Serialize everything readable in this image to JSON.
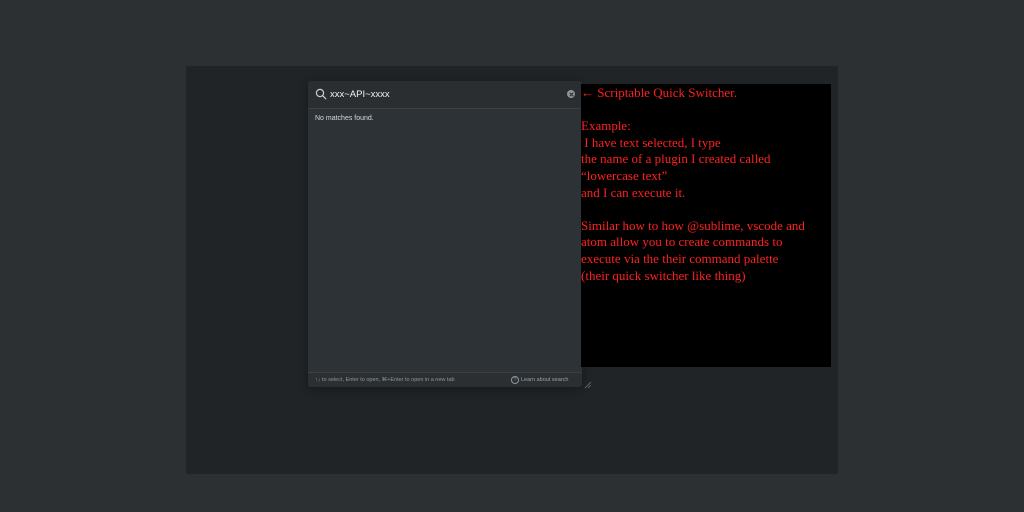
{
  "search": {
    "value": "xxx~API~xxxx",
    "icon": "search-icon",
    "clear_icon": "clear-icon"
  },
  "results": {
    "empty_message": "No matches found."
  },
  "footer": {
    "hint": "↑↓ to select, Enter to open, ⌘+Enter to open in a new tab",
    "help_icon_glyph": "?",
    "learn_link": "Learn about search"
  },
  "annotation": {
    "color": "#ff2020",
    "background": "#000000",
    "title": "← Scriptable Quick Switcher.",
    "example_heading": "Example:",
    "example_lines": [
      " I have text selected, I type",
      "the name of a plugin I created called",
      "“lowercase text”",
      "and I can execute it."
    ],
    "similar_lines": [
      "Similar how to how @sublime, vscode and",
      "atom allow you to create commands to",
      "execute via the their command palette",
      "(their quick switcher like thing)"
    ]
  }
}
